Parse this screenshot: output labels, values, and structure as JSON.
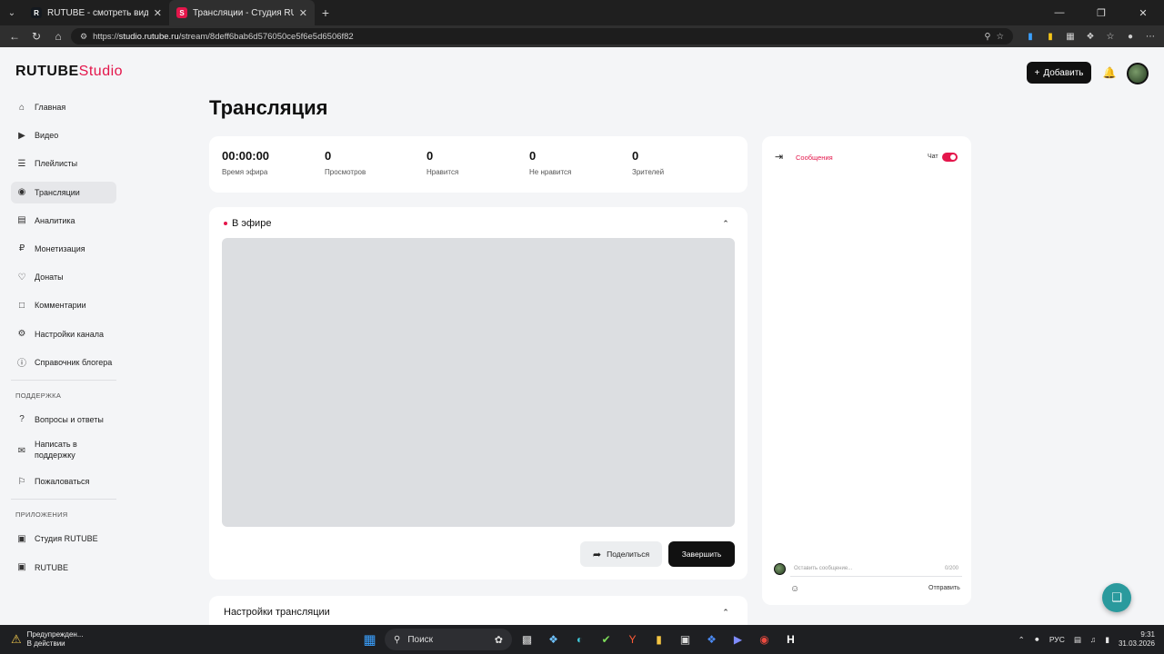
{
  "browser": {
    "tabs": [
      {
        "title": "RUTUBE - смотреть видео онлайн",
        "favicon": "R",
        "favicon_color": "#14191f"
      },
      {
        "title": "Трансляции - Студия RUTUBE",
        "favicon": "S",
        "favicon_color": "#e4164b"
      }
    ],
    "url_scheme": "https://",
    "url_host": "studio.rutube.ru",
    "url_path": "/stream/8deff6bab6d576050ce5f6e5d6506f82"
  },
  "header": {
    "logo_main": "RUTUBE",
    "logo_studio": "Studio",
    "add_label": "Добавить"
  },
  "sidebar": {
    "items": [
      {
        "label": "Главная",
        "icon": "home-icon"
      },
      {
        "label": "Видео",
        "icon": "video-icon"
      },
      {
        "label": "Плейлисты",
        "icon": "playlist-icon"
      },
      {
        "label": "Трансляции",
        "icon": "broadcast-icon"
      },
      {
        "label": "Аналитика",
        "icon": "analytics-icon"
      },
      {
        "label": "Монетизация",
        "icon": "money-icon"
      },
      {
        "label": "Донаты",
        "icon": "donate-icon"
      },
      {
        "label": "Комментарии",
        "icon": "comment-icon"
      },
      {
        "label": "Настройки канала",
        "icon": "gear-icon"
      },
      {
        "label": "Справочник блогера",
        "icon": "info-icon"
      }
    ],
    "support_heading": "ПОДДЕРЖКА",
    "support_items": [
      {
        "label": "Вопросы и ответы",
        "icon": "question-icon"
      },
      {
        "label": "Написать в поддержку",
        "icon": "mail-icon"
      },
      {
        "label": "Пожаловаться",
        "icon": "flag-icon"
      }
    ],
    "apps_heading": "ПРИЛОЖЕНИЯ",
    "app_items": [
      {
        "label": "Студия RUTUBE",
        "icon": "studio-icon"
      },
      {
        "label": "RUTUBE",
        "icon": "rutube-icon"
      }
    ]
  },
  "page": {
    "title": "Трансляция"
  },
  "stats": [
    {
      "value": "00:00:00",
      "label": "Время эфира"
    },
    {
      "value": "0",
      "label": "Просмотров"
    },
    {
      "value": "0",
      "label": "Нравится"
    },
    {
      "value": "0",
      "label": "Не нравится"
    },
    {
      "value": "0",
      "label": "Зрителей"
    }
  ],
  "live": {
    "status": "В эфире",
    "share_label": "Поделиться",
    "end_label": "Завершить"
  },
  "settings": {
    "title": "Настройки трансляции"
  },
  "chat": {
    "tab_messages": "Сообщения",
    "toggle_label": "Чат",
    "input_placeholder": "Оставить сообщение...",
    "counter": "0/200",
    "send_label": "Отправить"
  },
  "taskbar": {
    "warn_title": "Предупрежден...",
    "warn_sub": "В действии",
    "search_label": "Поиск",
    "lang": "РУС",
    "time": "9:31",
    "date": "31.03.2026"
  },
  "colors": {
    "accent": "#e4164b",
    "dark": "#111111",
    "background": "#f4f5f7"
  }
}
